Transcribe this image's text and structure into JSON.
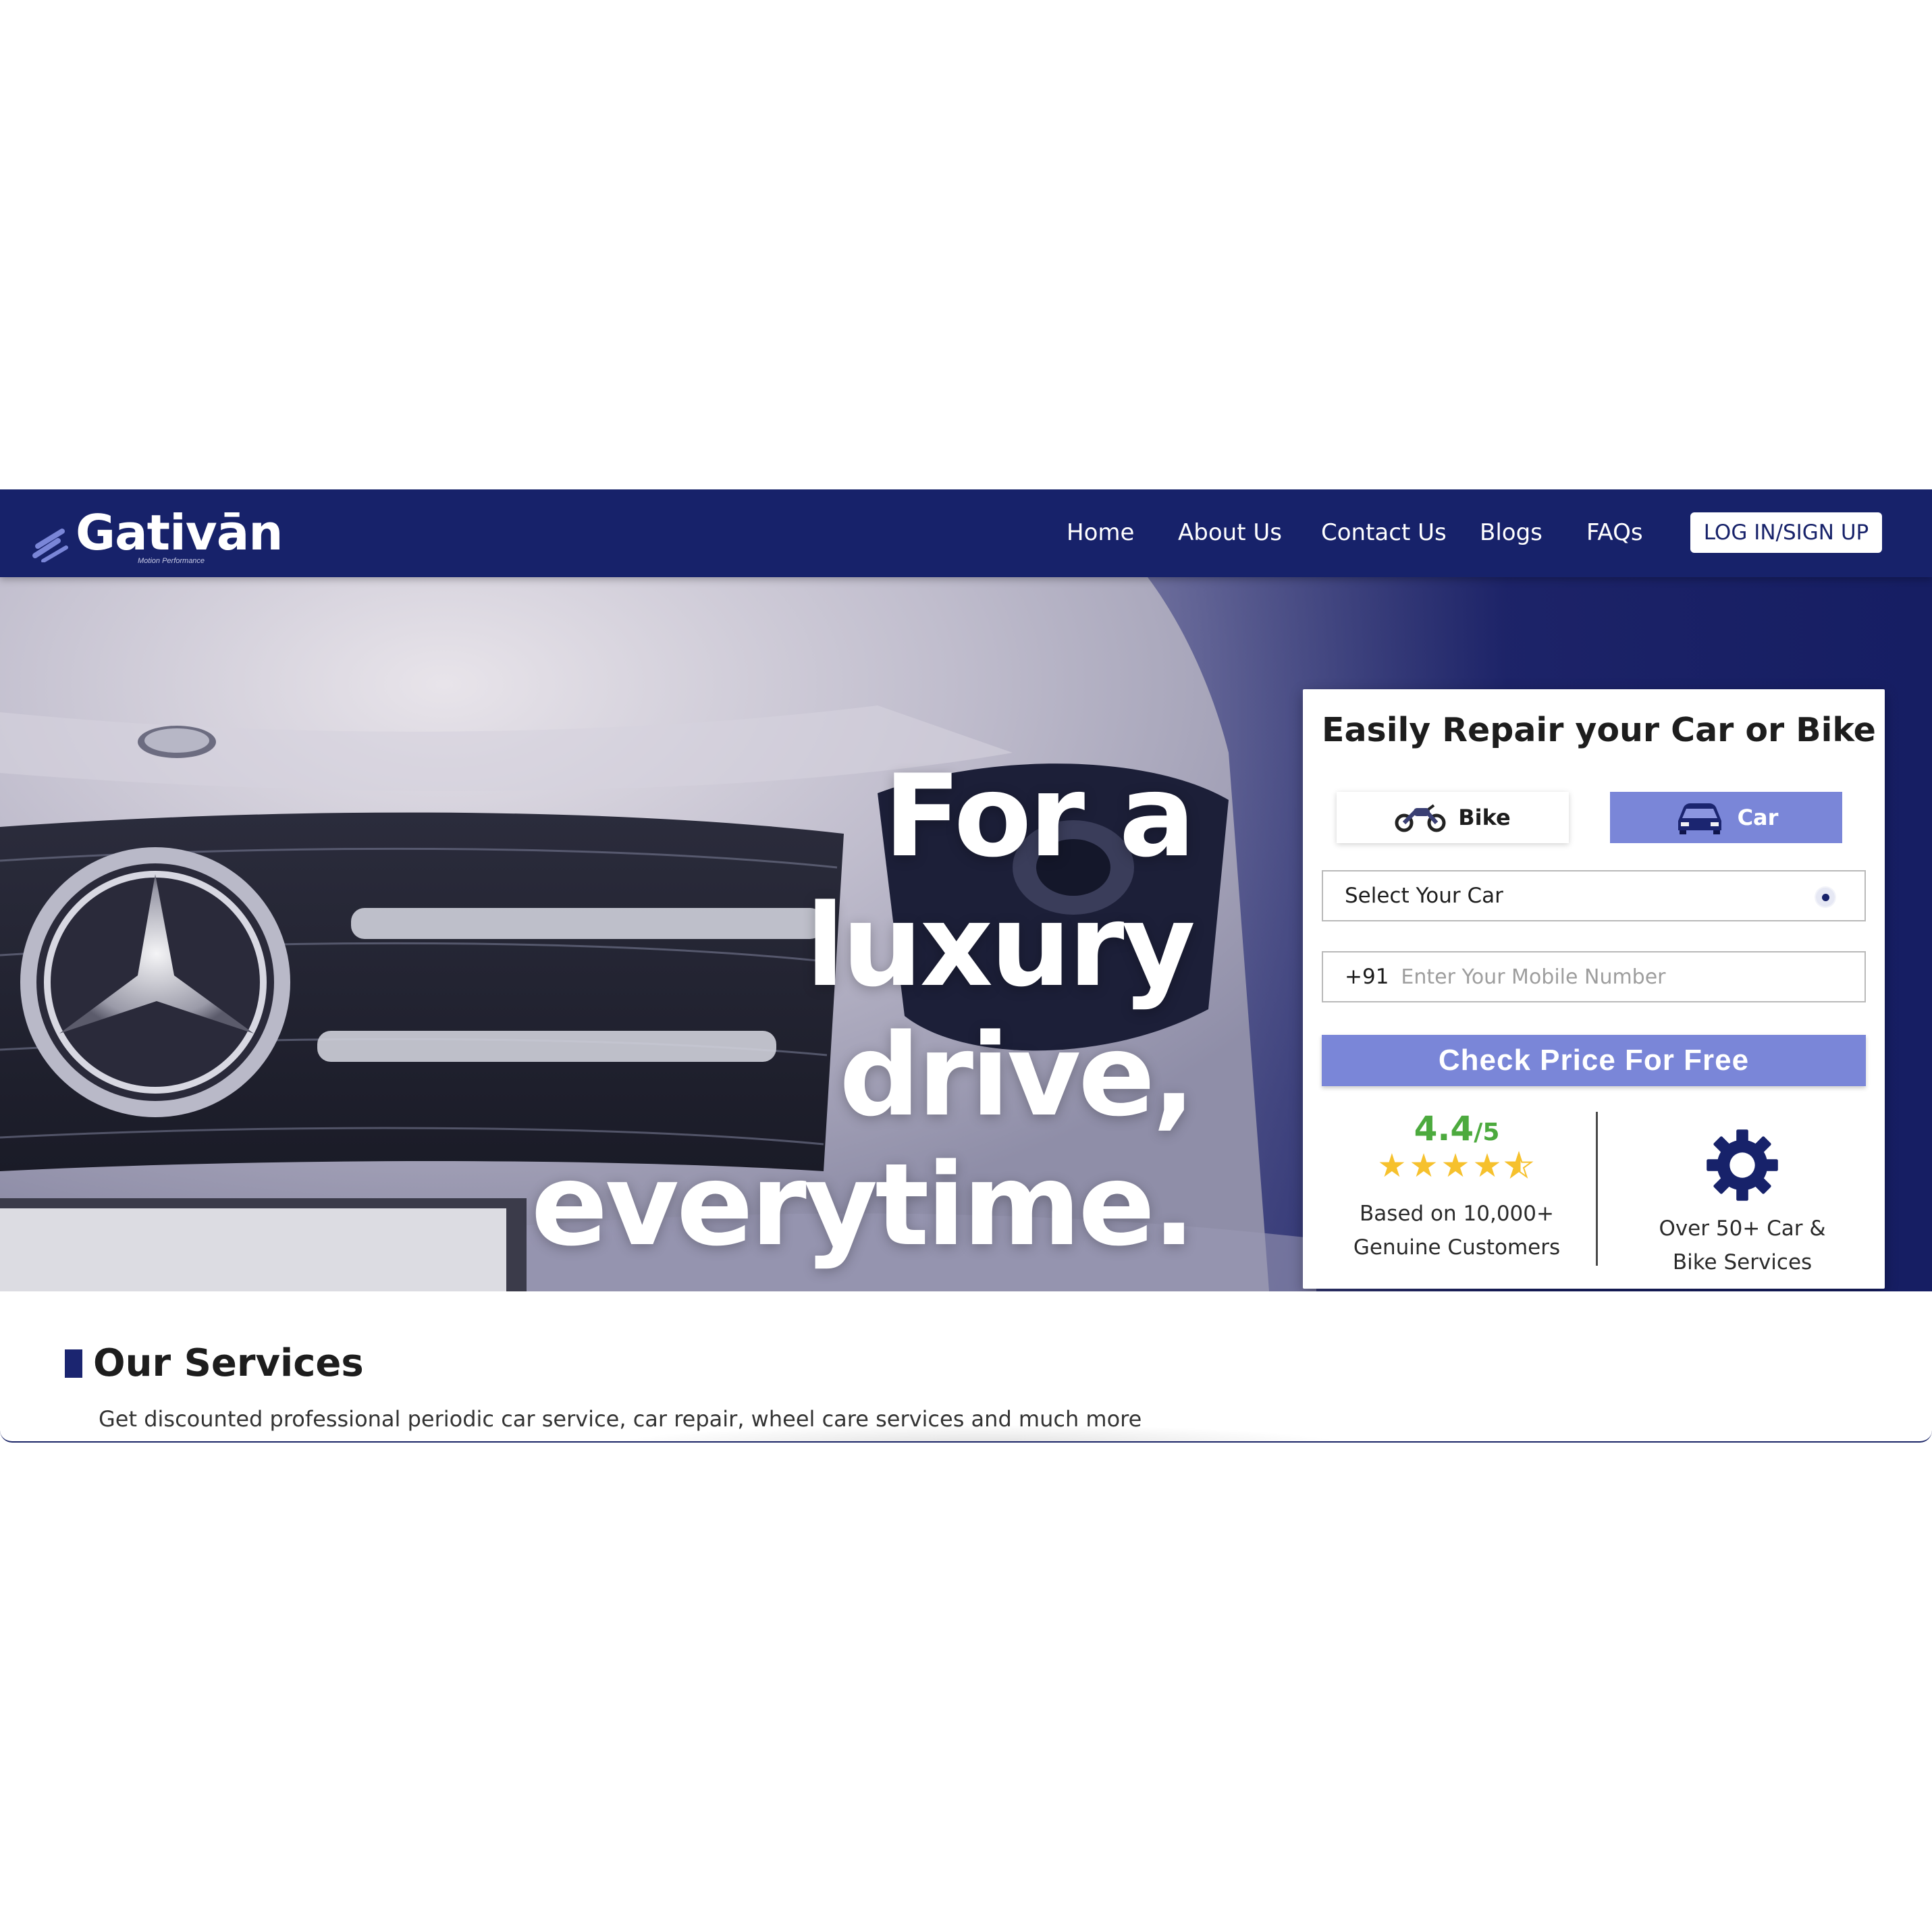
{
  "brand": {
    "name": "Gativān",
    "tagline": "Motion Performance"
  },
  "nav": {
    "links": [
      "Home",
      "About Us",
      "Contact Us",
      "Blogs",
      "FAQs"
    ],
    "login_label": "LOG IN/SIGN UP"
  },
  "hero": {
    "line1": "For a",
    "line2": "luxury drive,",
    "line3": "everytime."
  },
  "form": {
    "title": "Easily Repair your Car or Bike",
    "toggle": {
      "bike_label": "Bike",
      "car_label": "Car",
      "selected": "Car"
    },
    "select_label": "Select Your Car",
    "phone_prefix": "+91",
    "phone_placeholder": "Enter Your Mobile Number",
    "cta_label": "Check Price For Free"
  },
  "stats": {
    "rating_value": "4.4",
    "rating_outof": "/5",
    "rating_stars": 4.5,
    "rating_line1": "Based on 10,000+",
    "rating_line2": "Genuine Customers",
    "services_line1": "Over 50+ Car &",
    "services_line2": "Bike Services"
  },
  "services": {
    "title": "Our Services",
    "subtitle": "Get discounted professional periodic car service, car repair, wheel care services and much more"
  },
  "colors": {
    "brand_navy": "#17226a",
    "accent_periwinkle": "#7a86d8",
    "rating_green": "#4caa3e",
    "star_yellow": "#f6c12d"
  },
  "icons": {
    "logo": "speed-lines-icon",
    "bike": "motorcycle-icon",
    "car": "car-icon",
    "select": "radio-dot-icon",
    "services": "gear-icon"
  }
}
